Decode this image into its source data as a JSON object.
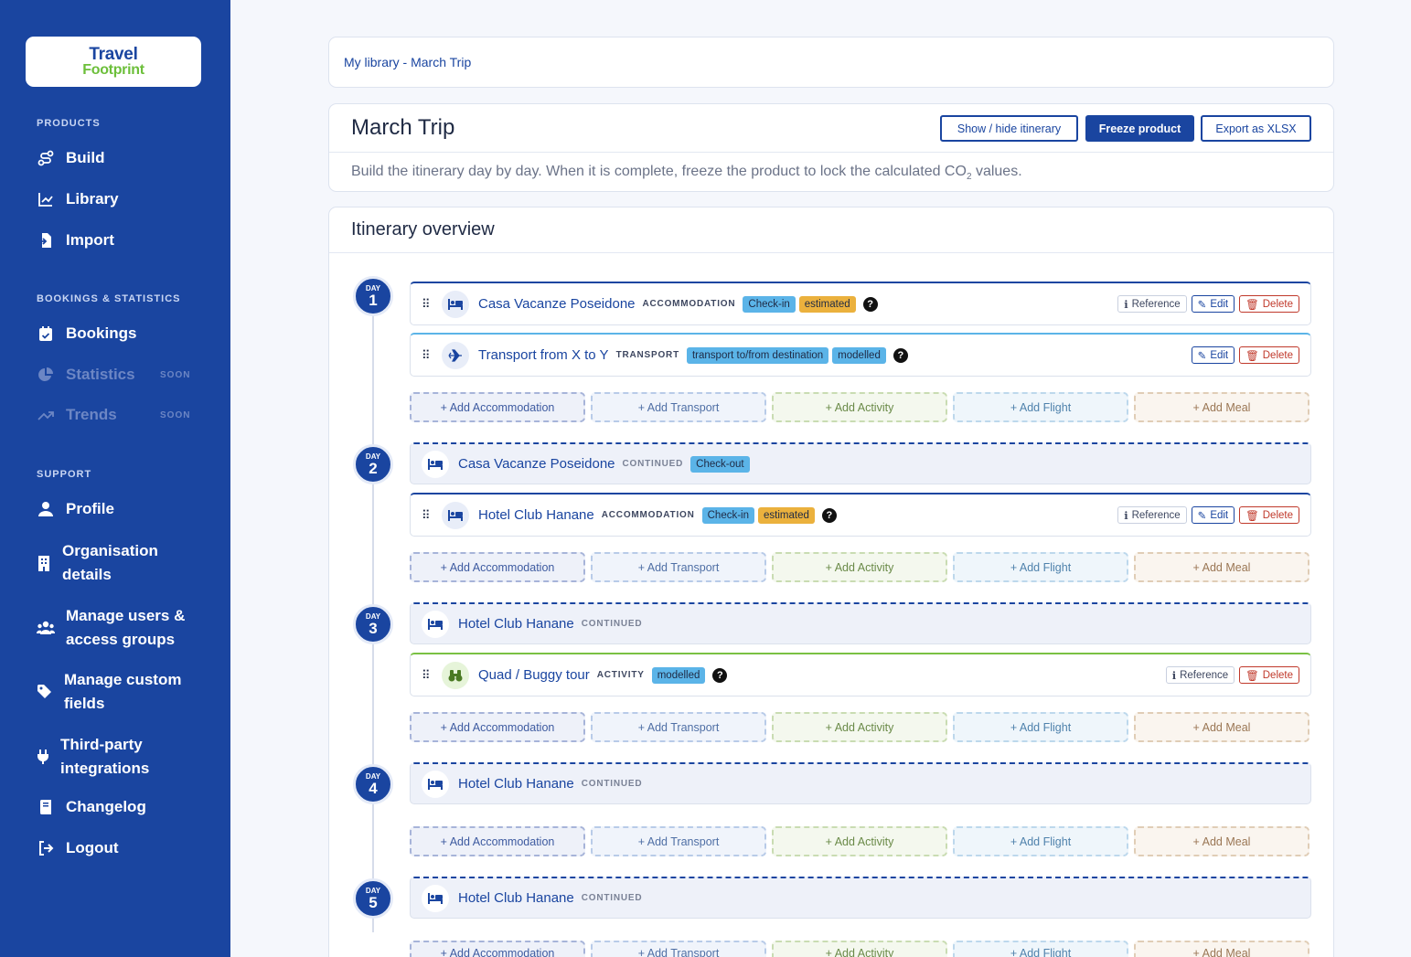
{
  "brand": {
    "line1": "Travel",
    "line2": "Footprint"
  },
  "sidebar": {
    "sections": {
      "products": "PRODUCTS",
      "bookings": "BOOKINGS & STATISTICS",
      "support": "SUPPORT"
    },
    "items": {
      "build": "Build",
      "library": "Library",
      "import": "Import",
      "bookings": "Bookings",
      "statistics": "Statistics",
      "trends": "Trends",
      "profile": "Profile",
      "org": "Organisation details",
      "users": "Manage users & access groups",
      "fields": "Manage custom fields",
      "integrations": "Third-party integrations",
      "changelog": "Changelog",
      "logout": "Logout"
    },
    "soon": "SOON"
  },
  "breadcrumb": "My library - March Trip",
  "header": {
    "title": "March Trip",
    "show_hide": "Show / hide itinerary",
    "freeze": "Freeze product",
    "export": "Export as XLSX",
    "desc_a": "Build the itinerary day by day. When it is complete, freeze the product to lock the calculated CO",
    "desc_sub": "2",
    "desc_b": " values."
  },
  "itinerary": {
    "title": "Itinerary overview",
    "day_label": "DAY",
    "days": [
      "1",
      "2",
      "3",
      "4",
      "5"
    ]
  },
  "items": {
    "casa_checkin": {
      "name": "Casa Vacanze Poseidone",
      "type": "ACCOMMODATION",
      "tag1": "Check-in",
      "tag2": "estimated"
    },
    "transport": {
      "name": "Transport from X to Y",
      "type": "TRANSPORT",
      "tag1": "transport to/from destination",
      "tag2": "modelled"
    },
    "casa_cont": {
      "name": "Casa Vacanze Poseidone",
      "type": "CONTINUED",
      "tag1": "Check-out"
    },
    "hanane_checkin": {
      "name": "Hotel Club Hanane",
      "type": "ACCOMMODATION",
      "tag1": "Check-in",
      "tag2": "estimated"
    },
    "hanane_cont3": {
      "name": "Hotel Club Hanane",
      "type": "CONTINUED"
    },
    "quad": {
      "name": "Quad / Buggy tour",
      "type": "ACTIVITY",
      "tag1": "modelled"
    },
    "hanane_cont4": {
      "name": "Hotel Club Hanane",
      "type": "CONTINUED"
    },
    "hanane_cont5": {
      "name": "Hotel Club Hanane",
      "type": "CONTINUED"
    }
  },
  "labels": {
    "help": "?",
    "reference": "Reference",
    "edit": "Edit",
    "delete": "Delete",
    "add_accommodation": "+ Add Accommodation",
    "add_transport": "+ Add Transport",
    "add_activity": "+ Add Activity",
    "add_flight": "+ Add Flight",
    "add_meal": "+ Add Meal"
  },
  "colors": {
    "primary": "#1a45a0",
    "accent_green": "#7ac143",
    "tag_blue": "#5bb4e8",
    "tag_orange": "#ebb13d",
    "danger": "#c0392b"
  }
}
